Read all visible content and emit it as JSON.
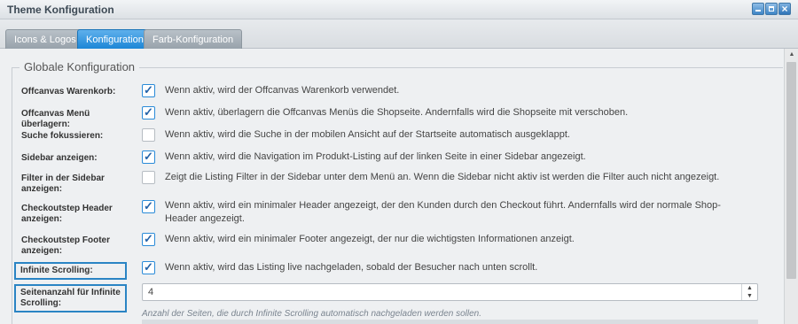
{
  "window": {
    "title": "Theme Konfiguration"
  },
  "tabs": [
    {
      "label": "Icons & Logos",
      "active": false
    },
    {
      "label": "Konfiguration",
      "active": true
    },
    {
      "label": "Farb-Konfiguration",
      "active": false
    }
  ],
  "section": {
    "legend": "Globale Konfiguration"
  },
  "settings": [
    {
      "label": "Offcanvas Warenkorb:",
      "checked": true,
      "description": "Wenn aktiv, wird der Offcanvas Warenkorb verwendet."
    },
    {
      "label": "Offcanvas Menü überlagern:",
      "checked": true,
      "description": "Wenn aktiv, überlagern die Offcanvas Menüs die Shopseite. Andernfalls wird die Shopseite mit verschoben."
    },
    {
      "label": "Suche fokussieren:",
      "checked": false,
      "description": "Wenn aktiv, wird die Suche in der mobilen Ansicht auf der Startseite automatisch ausgeklappt."
    },
    {
      "label": "Sidebar anzeigen:",
      "checked": true,
      "description": "Wenn aktiv, wird die Navigation im Produkt-Listing auf der linken Seite in einer Sidebar angezeigt."
    },
    {
      "label": "Filter in der Sidebar anzeigen:",
      "checked": false,
      "description": "Zeigt die Listing Filter in der Sidebar unter dem Menü an. Wenn die Sidebar nicht aktiv ist werden die Filter auch nicht angezeigt."
    },
    {
      "label": "Checkoutstep Header anzeigen:",
      "checked": true,
      "description": "Wenn aktiv, wird ein minimaler Header angezeigt, der den Kunden durch den Checkout führt. Andernfalls wird der normale Shop-Header angezeigt."
    },
    {
      "label": "Checkoutstep Footer anzeigen:",
      "checked": true,
      "description": "Wenn aktiv, wird ein minimaler Footer angezeigt, der nur die wichtigsten Informationen anzeigt."
    },
    {
      "label": "Infinite Scrolling:",
      "checked": true,
      "description": "Wenn aktiv, wird das Listing live nachgeladen, sobald der Besucher nach unten scrollt."
    }
  ],
  "pages_setting": {
    "label": "Seitenanzahl für Infinite Scrolling:",
    "value": "4",
    "helper": "Anzahl der Seiten, die durch Infinite Scrolling automatisch nachgeladen werden sollen."
  },
  "icons": {
    "minimize": "minimize-icon",
    "maximize": "maximize-icon",
    "close": "close-icon",
    "check": "checkmark-icon"
  },
  "colors": {
    "accent": "#1c86d6",
    "highlight_border": "#2a84c4"
  }
}
